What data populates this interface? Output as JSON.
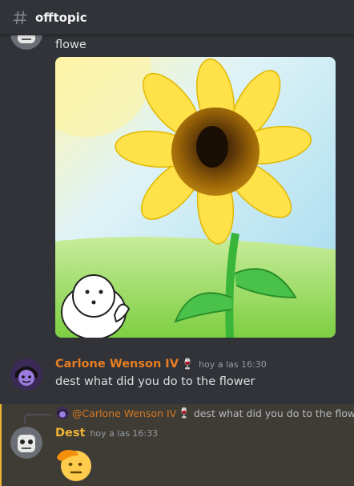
{
  "channel": {
    "name": "offtopic"
  },
  "messages": [
    {
      "text": "flowe"
    },
    {
      "author": "Carlone Wenson IV",
      "author_color": "#e67e22",
      "badge": "🍷",
      "timestamp": "hoy a las 16:30",
      "text": "dest what did you do to the flower"
    },
    {
      "author": "Dest",
      "author_color": "#f0b232",
      "timestamp": "hoy a las 16:33",
      "reply": {
        "author": "@Carlone Wenson IV",
        "badge": "🍷",
        "text": "dest what did you do to the flower"
      },
      "emoji": "saluting-face"
    }
  ],
  "colors": {
    "background": "#313338",
    "highlight": "#3f3c35",
    "mention_bar": "#f0b232"
  }
}
